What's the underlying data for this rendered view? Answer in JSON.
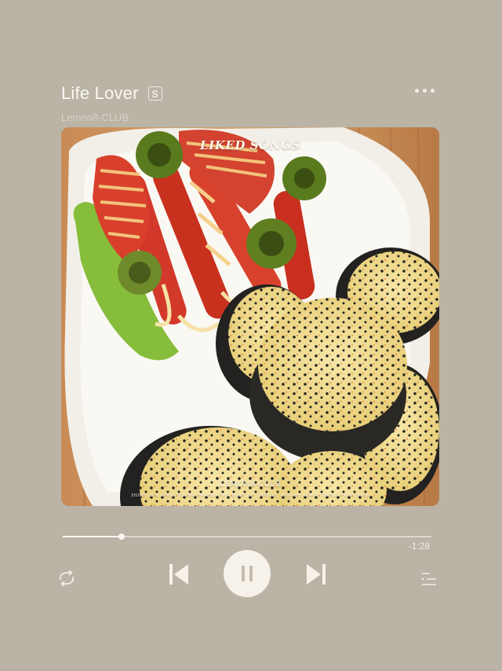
{
  "song": {
    "title": "Life Lover",
    "badge": "S",
    "artist": "Lemon8-CLUB"
  },
  "menu": {
    "icon": "more-horizontal-icon"
  },
  "artwork": {
    "banner": "LIKED SONGS",
    "watermark_brand": "LEMON8-CLUB",
    "watermark_slogan": "HOPE IS A GOOD THING, MAYBE THE BEST OF THINGS, AND NO GOOD THING EVER DIES",
    "subject": "plate of sausages, peppers and egg kimbap rolls"
  },
  "player": {
    "progress": 0.16,
    "time_remaining": "-1:28",
    "state": "playing"
  },
  "controls": {
    "repeat": "repeat-icon",
    "previous": "skip-previous-icon",
    "play_pause": "pause-icon",
    "next": "skip-next-icon",
    "queue": "queue-list-icon"
  },
  "colors": {
    "background": "#bab3a6",
    "text": "#fbf9f4",
    "secondary_text": "#d7d0c4",
    "button_fill": "#f6f2ea"
  }
}
